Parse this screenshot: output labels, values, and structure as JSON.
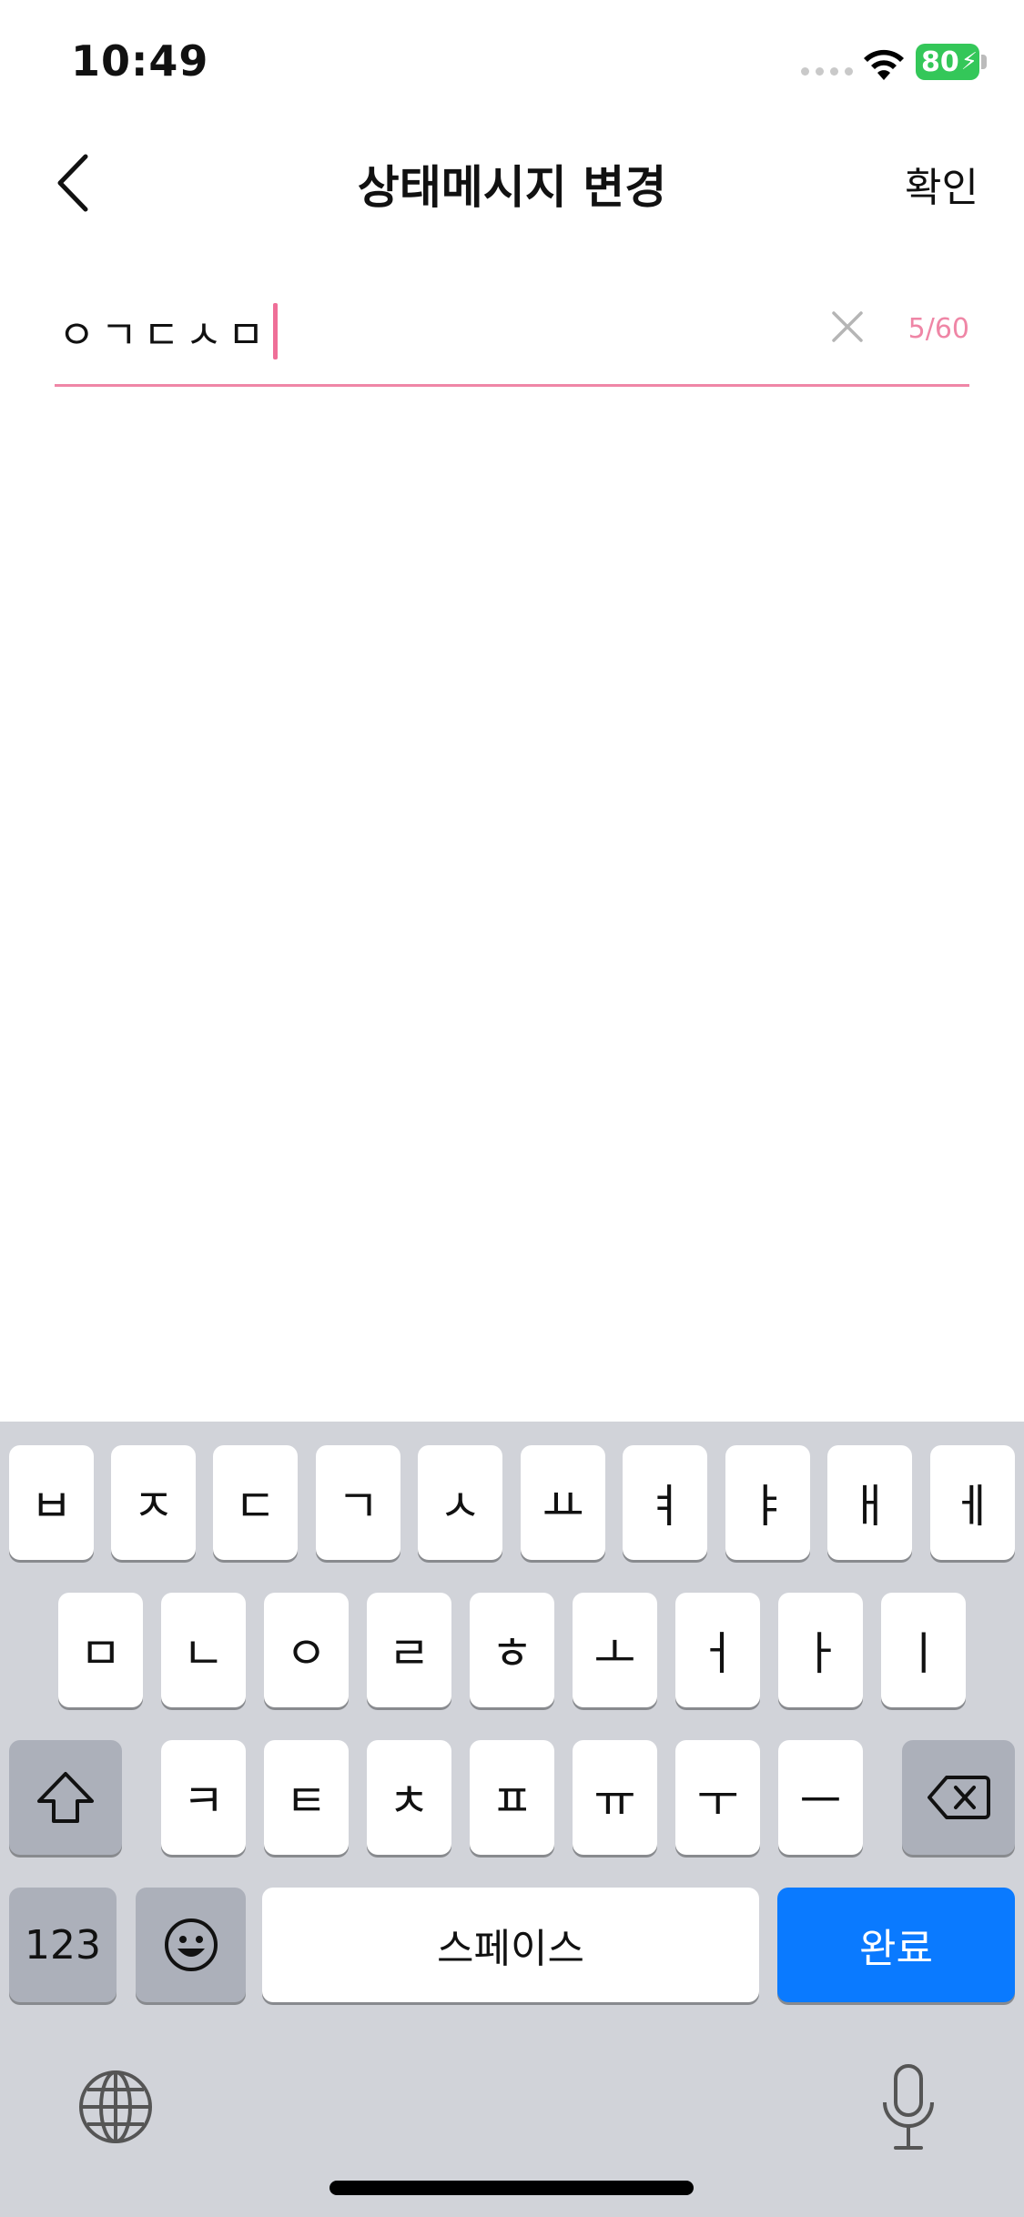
{
  "status_bar": {
    "time": "10:49",
    "battery": "80"
  },
  "nav": {
    "title": "상태메시지 변경",
    "confirm_label": "확인"
  },
  "input": {
    "value": "ㅇㄱㄷㅅㅁ",
    "counter": "5/60"
  },
  "keyboard": {
    "row1": [
      "ㅂ",
      "ㅈ",
      "ㄷ",
      "ㄱ",
      "ㅅ",
      "ㅛ",
      "ㅕ",
      "ㅑ",
      "ㅐ",
      "ㅔ"
    ],
    "row2": [
      "ㅁ",
      "ㄴ",
      "ㅇ",
      "ㄹ",
      "ㅎ",
      "ㅗ",
      "ㅓ",
      "ㅏ",
      "ㅣ"
    ],
    "row3": [
      "ㅋ",
      "ㅌ",
      "ㅊ",
      "ㅍ",
      "ㅠ",
      "ㅜ",
      "ㅡ"
    ],
    "numbers_label": "123",
    "space_label": "스페이스",
    "done_label": "완료"
  },
  "colors": {
    "accent": "#ef86a6",
    "done_key": "#0a7aff",
    "battery": "#34c759"
  }
}
